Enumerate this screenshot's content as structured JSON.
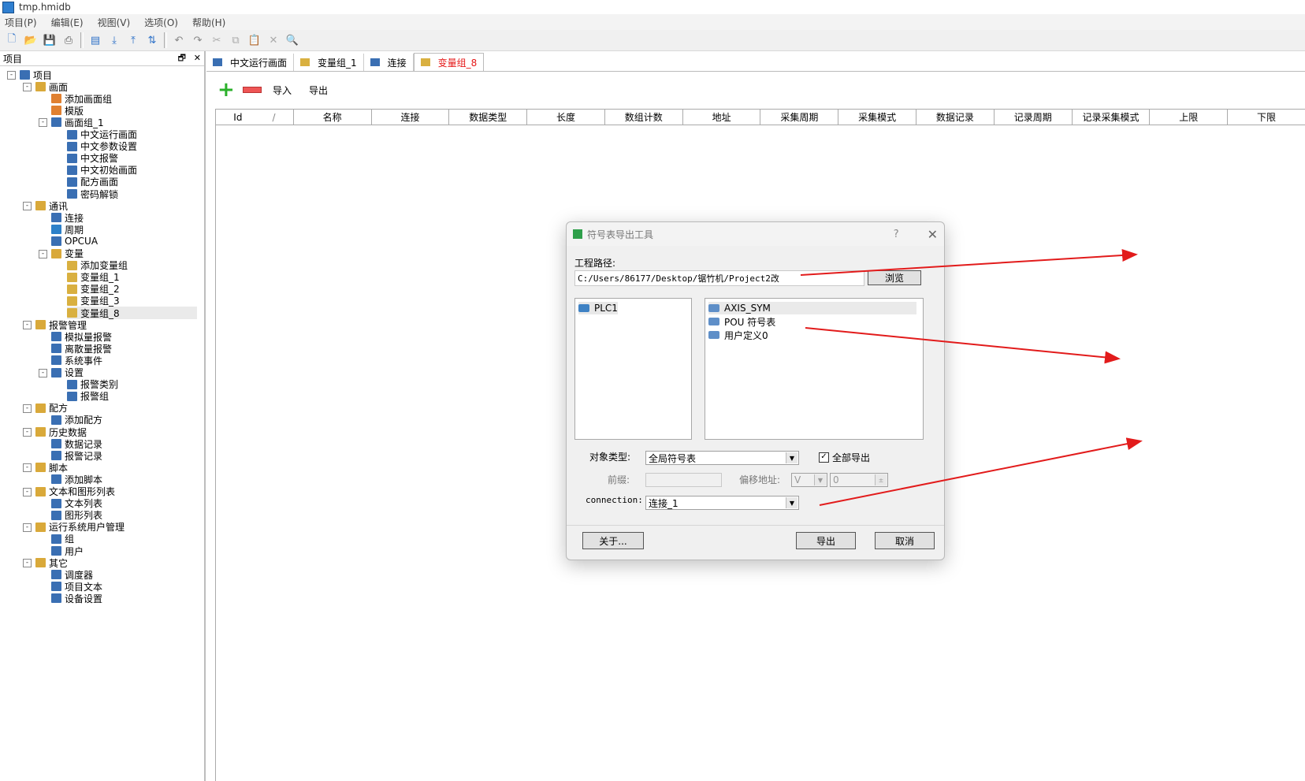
{
  "window": {
    "title": "tmp.hmidb"
  },
  "menu": [
    "项目(P)",
    "编辑(E)",
    "视图(V)",
    "选项(O)",
    "帮助(H)"
  ],
  "toolbar_icons": [
    "new-icon",
    "open-icon",
    "save-icon",
    "print-icon",
    "sep",
    "deploy-icon",
    "download-icon",
    "upload-icon",
    "transfer-icon",
    "sep",
    "undo-icon",
    "redo-icon",
    "cut-icon",
    "copy-icon",
    "paste-icon",
    "delete-icon",
    "find-icon"
  ],
  "project_panel": {
    "title": "项目",
    "pin": "🗗",
    "close": "✕",
    "tree": [
      {
        "label": "项目",
        "depth": 0,
        "exp": "-",
        "icon": "#3a6fb3"
      },
      {
        "label": "画面",
        "depth": 1,
        "exp": "-",
        "icon": "#d9a93a"
      },
      {
        "label": "添加画面组",
        "depth": 2,
        "icon": "#e08030"
      },
      {
        "label": "模版",
        "depth": 2,
        "icon": "#e08030"
      },
      {
        "label": "画面组_1",
        "depth": 2,
        "exp": "-",
        "icon": "#3a6fb3"
      },
      {
        "label": "中文运行画面",
        "depth": 3,
        "icon": "#3a6fb3"
      },
      {
        "label": "中文参数设置",
        "depth": 3,
        "icon": "#3a6fb3"
      },
      {
        "label": "中文报警",
        "depth": 3,
        "icon": "#3a6fb3"
      },
      {
        "label": "中文初始画面",
        "depth": 3,
        "icon": "#3a6fb3"
      },
      {
        "label": "配方画面",
        "depth": 3,
        "icon": "#3a6fb3"
      },
      {
        "label": "密码解锁",
        "depth": 3,
        "icon": "#3a6fb3"
      },
      {
        "label": "通讯",
        "depth": 1,
        "exp": "-",
        "icon": "#d9a93a"
      },
      {
        "label": "连接",
        "depth": 2,
        "icon": "#3a6fb3"
      },
      {
        "label": "周期",
        "depth": 2,
        "icon": "#2c80c9"
      },
      {
        "label": "OPCUA",
        "depth": 2,
        "icon": "#3a6fb3"
      },
      {
        "label": "变量",
        "depth": 2,
        "exp": "-",
        "icon": "#d9a93a"
      },
      {
        "label": "添加变量组",
        "depth": 3,
        "icon": "#d9b040"
      },
      {
        "label": "变量组_1",
        "depth": 3,
        "icon": "#d9b040"
      },
      {
        "label": "变量组_2",
        "depth": 3,
        "icon": "#d9b040"
      },
      {
        "label": "变量组_3",
        "depth": 3,
        "icon": "#d9b040"
      },
      {
        "label": "变量组_8",
        "depth": 3,
        "icon": "#d9b040",
        "selected": true
      },
      {
        "label": "报警管理",
        "depth": 1,
        "exp": "-",
        "icon": "#d9a93a"
      },
      {
        "label": "模拟量报警",
        "depth": 2,
        "icon": "#3a6fb3"
      },
      {
        "label": "离散量报警",
        "depth": 2,
        "icon": "#3a6fb3"
      },
      {
        "label": "系统事件",
        "depth": 2,
        "icon": "#3a6fb3"
      },
      {
        "label": "设置",
        "depth": 2,
        "exp": "-",
        "icon": "#3a6fb3"
      },
      {
        "label": "报警类别",
        "depth": 3,
        "icon": "#3a6fb3"
      },
      {
        "label": "报警组",
        "depth": 3,
        "icon": "#3a6fb3"
      },
      {
        "label": "配方",
        "depth": 1,
        "exp": "-",
        "icon": "#d9a93a"
      },
      {
        "label": "添加配方",
        "depth": 2,
        "icon": "#3a6fb3"
      },
      {
        "label": "历史数据",
        "depth": 1,
        "exp": "-",
        "icon": "#d9a93a"
      },
      {
        "label": "数据记录",
        "depth": 2,
        "icon": "#3a6fb3"
      },
      {
        "label": "报警记录",
        "depth": 2,
        "icon": "#3a6fb3"
      },
      {
        "label": "脚本",
        "depth": 1,
        "exp": "-",
        "icon": "#d9a93a"
      },
      {
        "label": "添加脚本",
        "depth": 2,
        "icon": "#3a6fb3"
      },
      {
        "label": "文本和图形列表",
        "depth": 1,
        "exp": "-",
        "icon": "#d9a93a"
      },
      {
        "label": "文本列表",
        "depth": 2,
        "icon": "#3a6fb3"
      },
      {
        "label": "图形列表",
        "depth": 2,
        "icon": "#3a6fb3"
      },
      {
        "label": "运行系统用户管理",
        "depth": 1,
        "exp": "-",
        "icon": "#d9a93a"
      },
      {
        "label": "组",
        "depth": 2,
        "icon": "#3a6fb3"
      },
      {
        "label": "用户",
        "depth": 2,
        "icon": "#3a6fb3"
      },
      {
        "label": "其它",
        "depth": 1,
        "exp": "-",
        "icon": "#d9a93a"
      },
      {
        "label": "调度器",
        "depth": 2,
        "icon": "#3a6fb3"
      },
      {
        "label": "项目文本",
        "depth": 2,
        "icon": "#3a6fb3"
      },
      {
        "label": "设备设置",
        "depth": 2,
        "icon": "#3a6fb3"
      }
    ]
  },
  "tabs": [
    {
      "label": "中文运行画面",
      "active": false
    },
    {
      "label": "变量组_1",
      "active": false
    },
    {
      "label": "连接",
      "active": false
    },
    {
      "label": "变量组_8",
      "active": true
    }
  ],
  "actions": {
    "import_label": "导入",
    "export_label": "导出"
  },
  "grid": {
    "columns": [
      {
        "label": "Id",
        "w": 100
      },
      {
        "label": "名称",
        "w": 100
      },
      {
        "label": "连接",
        "w": 100
      },
      {
        "label": "数据类型",
        "w": 100
      },
      {
        "label": "长度",
        "w": 100
      },
      {
        "label": "数组计数",
        "w": 100
      },
      {
        "label": "地址",
        "w": 100
      },
      {
        "label": "采集周期",
        "w": 100
      },
      {
        "label": "采集模式",
        "w": 100
      },
      {
        "label": "数据记录",
        "w": 100
      },
      {
        "label": "记录周期",
        "w": 100
      },
      {
        "label": "记录采集模式",
        "w": 100
      },
      {
        "label": "上限",
        "w": 100
      },
      {
        "label": "下限",
        "w": 100
      }
    ],
    "sort_mark": "/"
  },
  "dialog": {
    "title": "符号表导出工具",
    "help": "?",
    "close": "✕",
    "path_label": "工程路径:",
    "path_value": "C:/Users/86177/Desktop/锯竹机/Project2改",
    "browse_label": "浏览",
    "plc_list": [
      "PLC1"
    ],
    "symbol_list": [
      "AXIS_SYM",
      "POU 符号表",
      "用户定义0"
    ],
    "object_type_label": "对象类型:",
    "object_type_value": "全局符号表",
    "export_all_label": "全部导出",
    "export_all_checked": true,
    "prefix_label": "前缀:",
    "prefix_value": "",
    "offset_label": "偏移地址:",
    "offset_type": "V",
    "offset_value": "0",
    "connection_label": "connection:",
    "connection_value": "连接_1",
    "about_label": "关于...",
    "export_label": "导出",
    "cancel_label": "取消"
  },
  "colors": {
    "annotation_arrow": "#e21b1b",
    "active_tab": "#e51818",
    "accent_green": "#2bb02b"
  }
}
